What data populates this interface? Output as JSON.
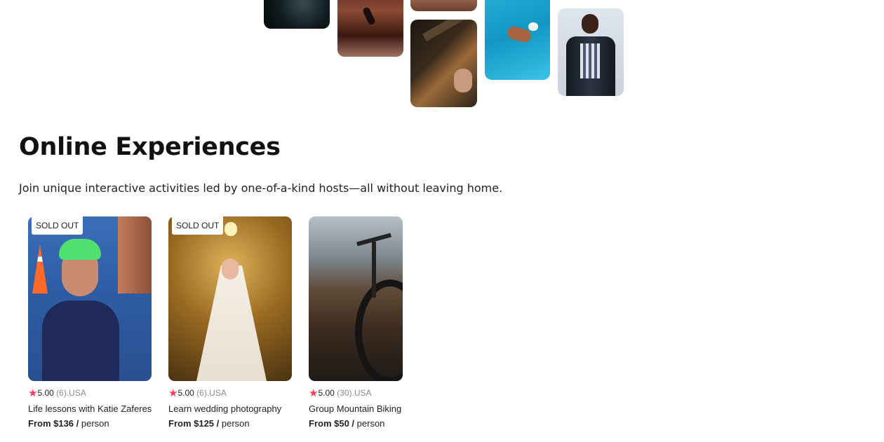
{
  "collage": {
    "tiles": [
      {
        "name": "dark-abstract-photo"
      },
      {
        "name": "ballet-dancer-photo"
      },
      {
        "name": "guitar-top-photo"
      },
      {
        "name": "guitar-player-photo"
      },
      {
        "name": "swimmer-photo"
      },
      {
        "name": "dark-top-photo"
      },
      {
        "name": "singer-microphone-photo"
      }
    ]
  },
  "section": {
    "title": "Online Experiences",
    "subtitle": "Join unique interactive activities led by one-of-a-kind hosts—all without leaving home."
  },
  "cards": [
    {
      "badge": "SOLD OUT",
      "rating": "5.00",
      "count": "(6)",
      "country": "USA",
      "title": "Life lessons with Katie Zaferes",
      "price_bold": "From $136 /",
      "price_unit": "person"
    },
    {
      "badge": "SOLD OUT",
      "rating": "5.00",
      "count": "(6)",
      "country": "USA",
      "title": "Learn wedding photography",
      "price_bold": "From $125 /",
      "price_unit": "person"
    },
    {
      "badge": "",
      "rating": "5.00",
      "count": "(30)",
      "country": "USA",
      "title": "Group Mountain Biking",
      "price_bold": "From $50 /",
      "price_unit": "person"
    }
  ],
  "icons": {
    "rating": "star-icon"
  },
  "colors": {
    "star": "#fe395c",
    "muted": "#8a8a8a",
    "text": "#222222"
  }
}
